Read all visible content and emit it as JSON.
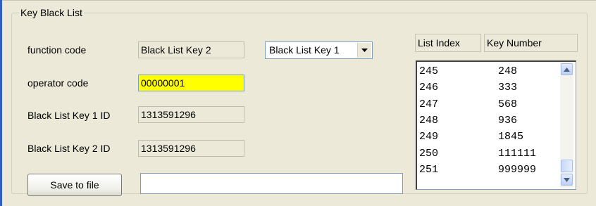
{
  "group": {
    "title": "Key Black List"
  },
  "fields": {
    "function_code": {
      "label": "function code",
      "value": "Black List Key 2"
    },
    "operator_code": {
      "label": "operator code",
      "value": "00000001"
    },
    "key1_id": {
      "label": "Black List Key 1 ID",
      "value": "1313591296"
    },
    "key2_id": {
      "label": "Black List Key 2 ID",
      "value": "1313591296"
    }
  },
  "combo": {
    "selected": "Black List Key 1",
    "icon": "chevron-down-icon"
  },
  "save_button": {
    "label": "Save to file"
  },
  "path_input": {
    "value": ""
  },
  "list": {
    "headers": [
      "List Index",
      "Key Number"
    ],
    "rows": [
      {
        "index": "245",
        "key": "248"
      },
      {
        "index": "246",
        "key": "333"
      },
      {
        "index": "247",
        "key": "568"
      },
      {
        "index": "248",
        "key": "936"
      },
      {
        "index": "249",
        "key": "1845"
      },
      {
        "index": "250",
        "key": "111111"
      },
      {
        "index": "251",
        "key": "999999"
      }
    ]
  },
  "colors": {
    "window_bg": "#ece9d8",
    "highlight_field": "#ffff00",
    "accent_bar": "#2f5fc4"
  }
}
